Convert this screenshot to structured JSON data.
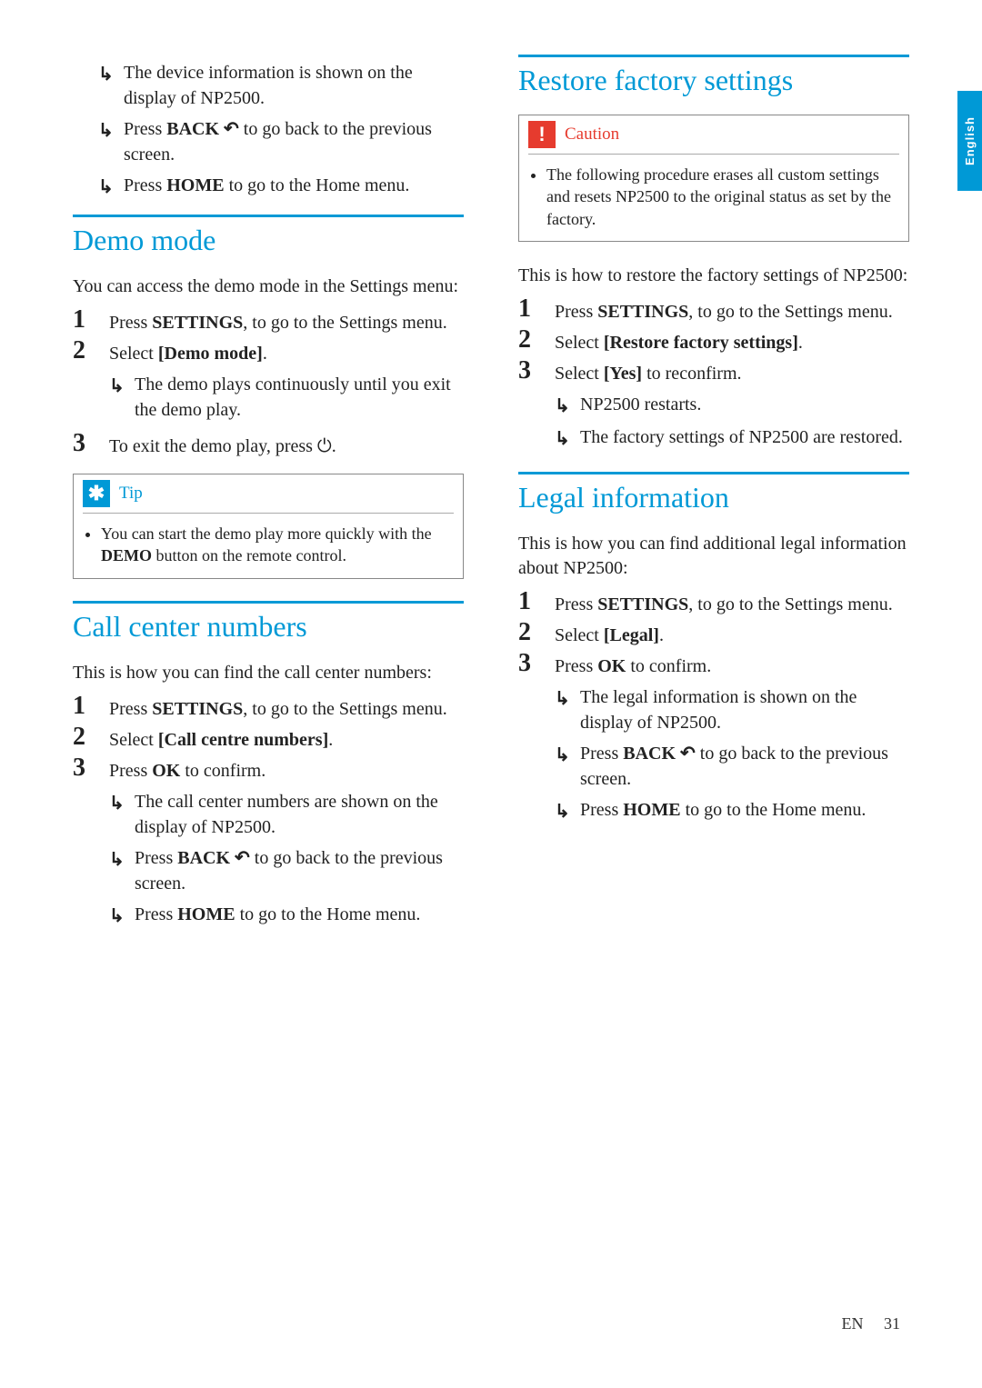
{
  "lang_tab": "English",
  "col1": {
    "intro_results": [
      "The device information is shown on the display of NP2500.",
      "Press <b>BACK ↶</b> to go back to the previous screen.",
      "Press <b>HOME</b> to go to the Home menu."
    ],
    "demo": {
      "heading": "Demo mode",
      "intro": "You can access the demo mode in the Settings menu:",
      "steps": [
        "Press <b>SETTINGS</b>, to go to the Settings menu.",
        "Select <b>[Demo mode]</b>.",
        "To exit the demo play, press ⏻."
      ],
      "step2_results": [
        "The demo plays continuously until you exit the demo play."
      ],
      "tip_label": "Tip",
      "tip_text": "You can start the demo play more quickly with the <b>DEMO</b> button on the remote control."
    },
    "call": {
      "heading": "Call center numbers",
      "intro": "This is how you can find the call center numbers:",
      "steps": [
        "Press <b>SETTINGS</b>, to go to the Settings menu.",
        "Select <b>[Call centre numbers]</b>.",
        "Press <b>OK</b> to confirm."
      ],
      "step3_results": [
        "The call center numbers are shown on the display of NP2500.",
        "Press <b>BACK ↶</b> to go back to the previous screen.",
        "Press <b>HOME</b> to go to the Home menu."
      ]
    }
  },
  "col2": {
    "restore": {
      "heading": "Restore factory settings",
      "caution_label": "Caution",
      "caution_text": "The following procedure erases all custom settings and resets NP2500 to the original status as set by the factory.",
      "intro": "This is how to restore the factory settings of NP2500:",
      "steps": [
        "Press <b>SETTINGS</b>, to go to the Settings menu.",
        "Select <b>[Restore factory settings]</b>.",
        "Select <b>[Yes]</b> to reconfirm."
      ],
      "step3_results": [
        "NP2500 restarts.",
        "The factory settings of NP2500 are restored."
      ]
    },
    "legal": {
      "heading": "Legal information",
      "intro": "This is how you can find additional legal information about NP2500:",
      "steps": [
        "Press <b>SETTINGS</b>, to go to the Settings menu.",
        "Select <b>[Legal]</b>.",
        "Press <b>OK</b> to confirm."
      ],
      "step3_results": [
        "The legal information is shown on the display of NP2500.",
        "Press <b>BACK ↶</b> to go back to the previous screen.",
        "Press <b>HOME</b> to go to the Home menu."
      ]
    }
  },
  "footer": {
    "lang": "EN",
    "page": "31"
  }
}
